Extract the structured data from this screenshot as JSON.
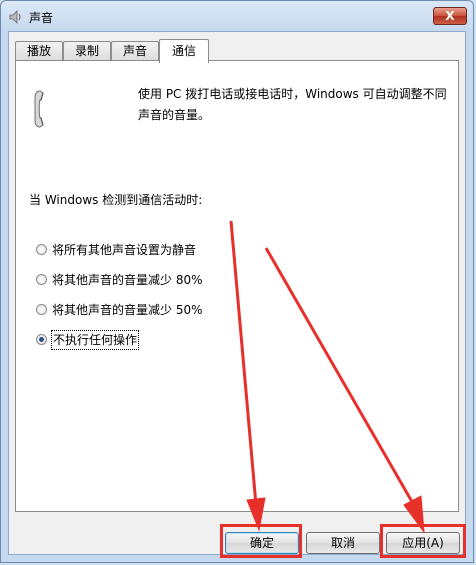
{
  "window": {
    "title": "声音",
    "close_label": "X"
  },
  "tabs": [
    {
      "label": "播放",
      "active": false
    },
    {
      "label": "录制",
      "active": false
    },
    {
      "label": "声音",
      "active": false
    },
    {
      "label": "通信",
      "active": true
    }
  ],
  "panel": {
    "description": "使用 PC 拨打电话或接电话时，Windows 可自动调整不同声音的音量。",
    "group_label": "当 Windows 检测到通信活动时:",
    "options": [
      {
        "label": "将所有其他声音设置为静音",
        "checked": false
      },
      {
        "label": "将其他声音的音量减少 80%",
        "checked": false
      },
      {
        "label": "将其他声音的音量减少 50%",
        "checked": false
      },
      {
        "label": "不执行任何操作",
        "checked": true
      }
    ]
  },
  "buttons": {
    "ok": "确定",
    "cancel": "取消",
    "apply": "应用(A)"
  },
  "colors": {
    "annotation_red": "#e8302a",
    "title_gradient_top": "#dbe9f7",
    "frame": "#c6d9ee"
  },
  "icons": {
    "app": "speaker-icon",
    "panel": "telephone-handset-icon"
  }
}
